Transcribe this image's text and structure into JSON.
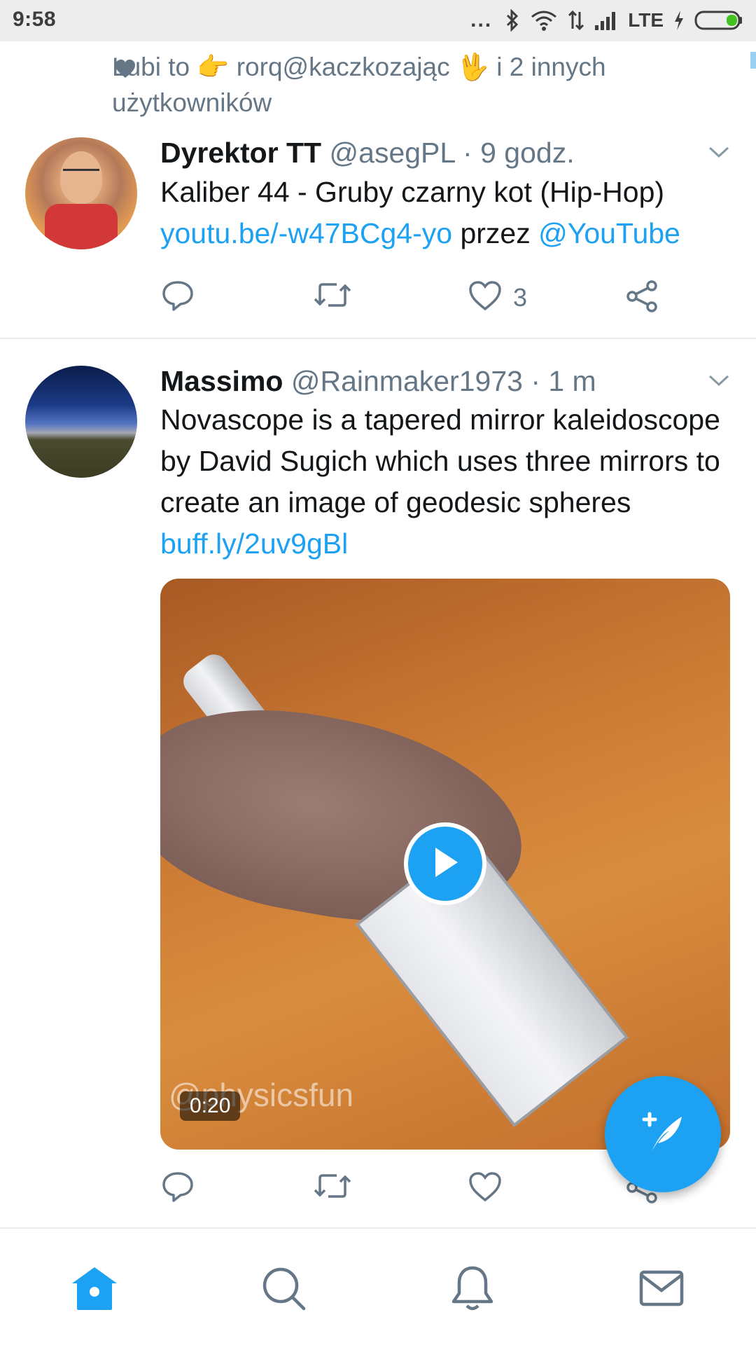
{
  "status_bar": {
    "time": "9:58",
    "dots": "...",
    "network": "LTE",
    "icons": [
      "bluetooth-icon",
      "wifi-icon",
      "data-arrows-icon",
      "signal-icon",
      "charging-icon",
      "battery-icon"
    ]
  },
  "timeline": {
    "social_context": {
      "icon": "heart-icon",
      "text": "Lubi to 👉 rorq@kaczkozając 🖖 i 2 innych użytkowników"
    },
    "tweets": [
      {
        "name": "Dyrektor TT",
        "meta": "@asegPL · 9 godz.",
        "text_before": "Kaliber 44 - Gruby czarny kot (Hip-Hop) ",
        "link": "youtu.be/-w47BCg4-yo",
        "text_middle": " przez ",
        "mention": "@YouTube",
        "like_count": "3"
      },
      {
        "name": "Massimo",
        "meta": "@Rainmaker1973 · 1 m",
        "text_before": "Novascope is a tapered mirror kaleidoscope by David Sugich which uses three mirrors to create an image of geodesic spheres ",
        "link": "buff.ly/2uv9gBl",
        "media": {
          "watermark": "@physicsfun",
          "duration": "0:20"
        }
      }
    ]
  },
  "colors": {
    "accent": "#1da1f2",
    "text": "#14171a",
    "secondary": "#657786",
    "divider": "#e6ecf0",
    "status_bar_bg": "#ededed"
  },
  "bottom_nav": {
    "items": [
      "home-icon",
      "search-icon",
      "notifications-icon",
      "messages-icon"
    ],
    "active": "home-icon"
  }
}
